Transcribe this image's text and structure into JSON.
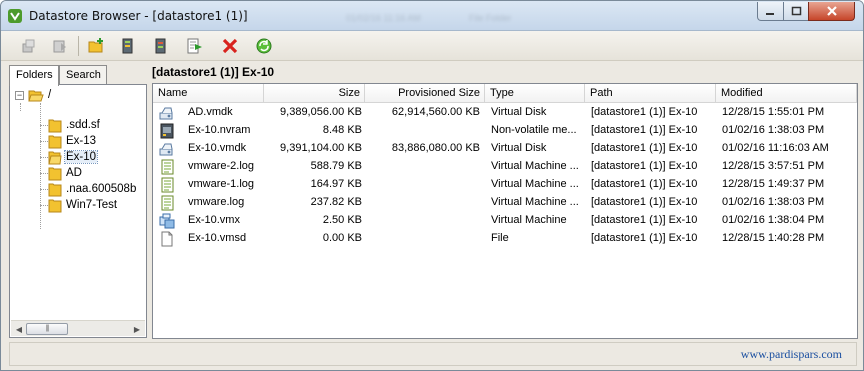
{
  "window": {
    "title": "Datastore Browser - [datastore1 (1)]",
    "background_ghost": [
      "01/02/16 11:16 AM",
      "File Folder"
    ],
    "controls": {
      "minimize": "minimize",
      "maximize": "maximize",
      "close": "close"
    }
  },
  "toolbar": {
    "buttons": [
      {
        "name": "upload-button",
        "icon": "upload-icon",
        "enabled": false
      },
      {
        "name": "download-button",
        "icon": "download-icon",
        "enabled": false
      },
      {
        "name": "new-folder-button",
        "icon": "new-folder-icon",
        "enabled": true
      },
      {
        "name": "register-vm-button",
        "icon": "register-vm-icon",
        "enabled": true
      },
      {
        "name": "inventory-button",
        "icon": "inventory-icon",
        "enabled": true
      },
      {
        "name": "move-button",
        "icon": "move-icon",
        "enabled": true
      },
      {
        "name": "delete-button",
        "icon": "delete-icon",
        "enabled": true
      },
      {
        "name": "refresh-button",
        "icon": "refresh-icon",
        "enabled": true
      }
    ]
  },
  "sidebar": {
    "tabs": [
      {
        "label": "Folders",
        "active": true
      },
      {
        "label": "Search",
        "active": false
      }
    ],
    "root": {
      "label": "/"
    },
    "items": [
      {
        "label": ".sdd.sf",
        "selected": false
      },
      {
        "label": "Ex-13",
        "selected": false
      },
      {
        "label": "Ex-10",
        "selected": true
      },
      {
        "label": "AD",
        "selected": false
      },
      {
        "label": ".naa.600508b",
        "selected": false
      },
      {
        "label": "Win7-Test",
        "selected": false
      }
    ]
  },
  "main": {
    "path": "[datastore1 (1)] Ex-10",
    "columns": {
      "name": "Name",
      "size": "Size",
      "provisioned": "Provisioned Size",
      "type": "Type",
      "path": "Path",
      "modified": "Modified"
    },
    "rows": [
      {
        "icon": "virtual-disk-icon",
        "name": "AD.vmdk",
        "size": "9,389,056.00 KB",
        "provisioned": "62,914,560.00 KB",
        "type": "Virtual Disk",
        "path": "[datastore1 (1)] Ex-10",
        "modified": "12/28/15 1:55:01 PM"
      },
      {
        "icon": "nvram-icon",
        "name": "Ex-10.nvram",
        "size": "8.48 KB",
        "provisioned": "",
        "type": "Non-volatile me...",
        "path": "[datastore1 (1)] Ex-10",
        "modified": "01/02/16 1:38:03 PM"
      },
      {
        "icon": "virtual-disk-icon",
        "name": "Ex-10.vmdk",
        "size": "9,391,104.00 KB",
        "provisioned": "83,886,080.00 KB",
        "type": "Virtual Disk",
        "path": "[datastore1 (1)] Ex-10",
        "modified": "01/02/16 11:16:03 AM"
      },
      {
        "icon": "log-file-icon",
        "name": "vmware-2.log",
        "size": "588.79 KB",
        "provisioned": "",
        "type": "Virtual Machine ...",
        "path": "[datastore1 (1)] Ex-10",
        "modified": "12/28/15 3:57:51 PM"
      },
      {
        "icon": "log-file-icon",
        "name": "vmware-1.log",
        "size": "164.97 KB",
        "provisioned": "",
        "type": "Virtual Machine ...",
        "path": "[datastore1 (1)] Ex-10",
        "modified": "12/28/15 1:49:37 PM"
      },
      {
        "icon": "log-file-icon",
        "name": "vmware.log",
        "size": "237.82 KB",
        "provisioned": "",
        "type": "Virtual Machine ...",
        "path": "[datastore1 (1)] Ex-10",
        "modified": "01/02/16 1:38:03 PM"
      },
      {
        "icon": "virtual-machine-icon",
        "name": "Ex-10.vmx",
        "size": "2.50 KB",
        "provisioned": "",
        "type": "Virtual Machine",
        "path": "[datastore1 (1)] Ex-10",
        "modified": "01/02/16 1:38:04 PM"
      },
      {
        "icon": "file-icon",
        "name": "Ex-10.vmsd",
        "size": "0.00 KB",
        "provisioned": "",
        "type": "File",
        "path": "[datastore1 (1)] Ex-10",
        "modified": "12/28/15 1:40:28 PM"
      }
    ]
  },
  "status": {
    "watermark": "www.pardispars.com"
  },
  "colors": {
    "folder": "#f2c230",
    "accent": "#1a4fa0",
    "delete": "#d8231e",
    "refresh": "#2c9a2c"
  }
}
